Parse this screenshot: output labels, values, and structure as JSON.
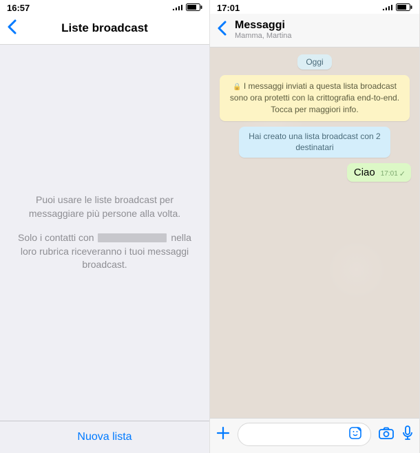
{
  "left": {
    "status_time": "16:57",
    "nav_title": "Liste broadcast",
    "info1": "Puoi usare le liste broadcast per messaggiare più persone alla volta.",
    "info2_pre": "Solo i contatti con",
    "info2_post": "nella loro rubrica riceveranno i tuoi messaggi broadcast.",
    "footer": "Nuova lista"
  },
  "right": {
    "status_time": "17:01",
    "nav_title": "Messaggi",
    "nav_subtitle": "Mamma, Martina",
    "date": "Oggi",
    "encryption": "I messaggi inviati a questa lista broadcast sono ora protetti con la crittografia end-to-end. Tocca per maggiori info.",
    "system_msg": "Hai creato una lista broadcast con 2 destinatari",
    "out_msg": "Ciao",
    "out_time": "17:01"
  }
}
